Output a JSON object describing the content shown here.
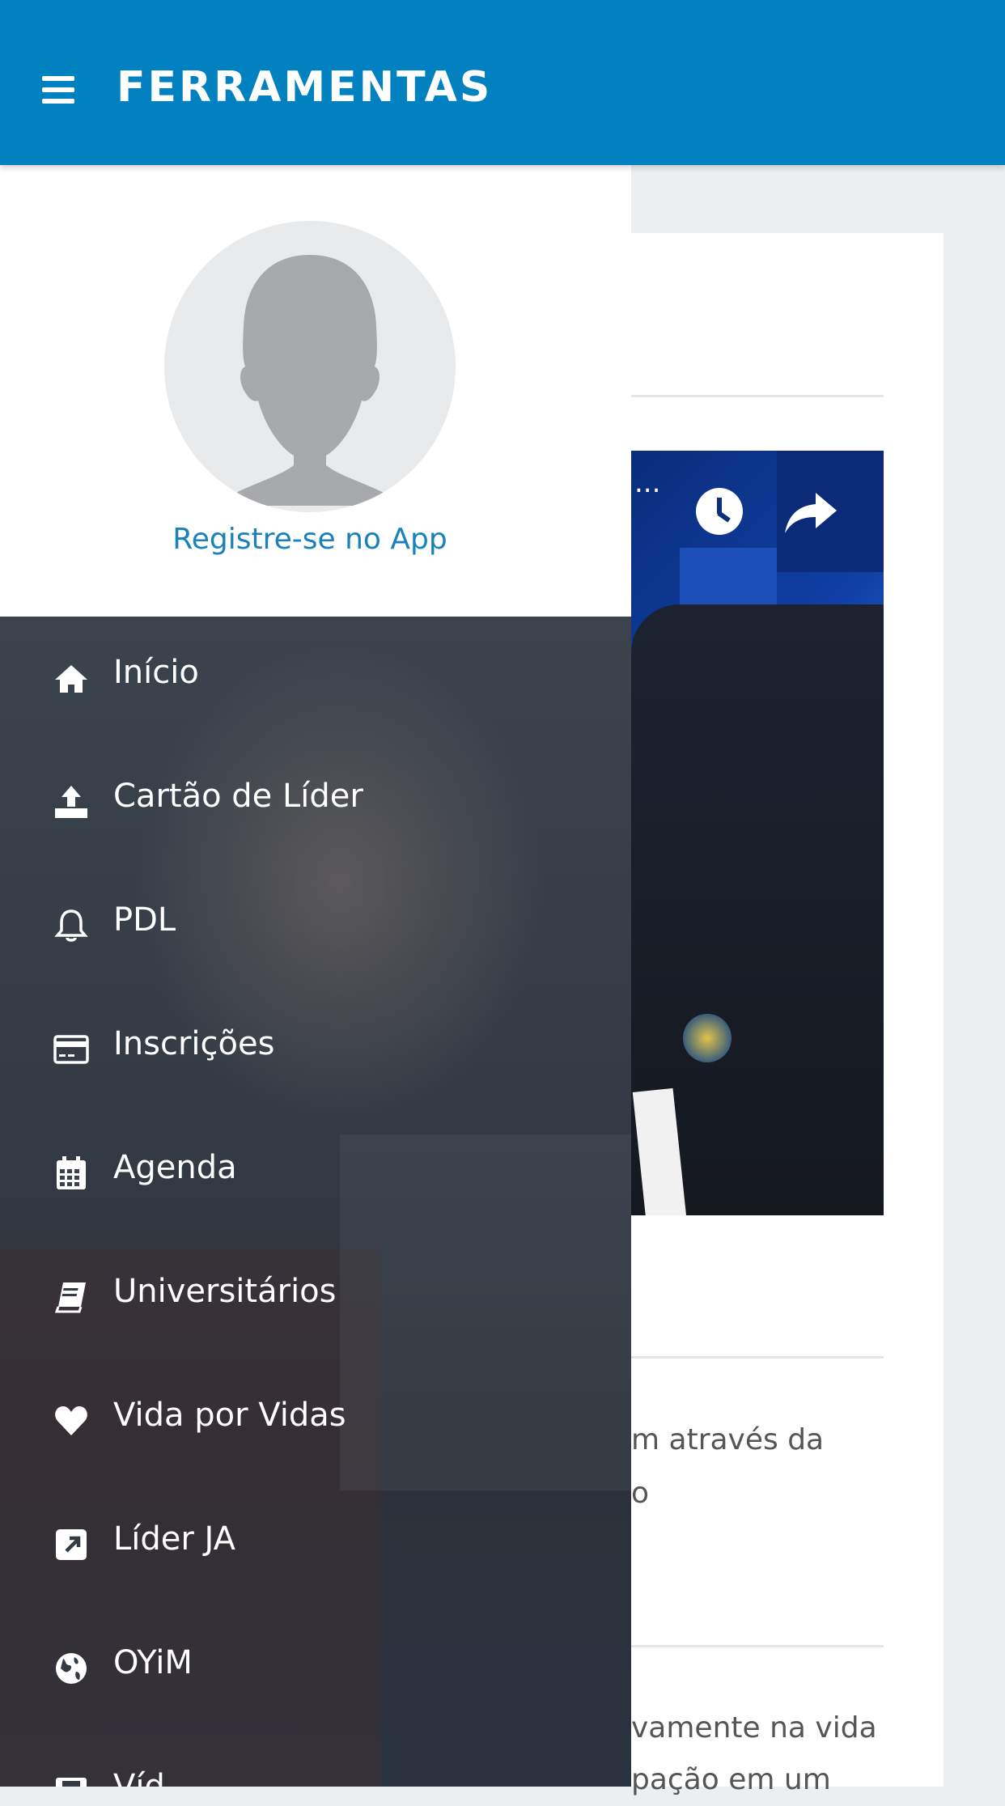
{
  "header": {
    "title": "FERRAMENTAS"
  },
  "drawer": {
    "register_label": "Registre-se no App",
    "items": [
      {
        "label": "Início",
        "icon": "home-icon"
      },
      {
        "label": "Cartão de Líder",
        "icon": "upload-icon"
      },
      {
        "label": "PDL",
        "icon": "bell-icon"
      },
      {
        "label": "Inscrições",
        "icon": "credit-card-icon"
      },
      {
        "label": "Agenda",
        "icon": "calendar-icon"
      },
      {
        "label": "Universitários",
        "icon": "book-icon"
      },
      {
        "label": "Vida por Vidas",
        "icon": "heart-icon"
      },
      {
        "label": "Líder JA",
        "icon": "external-link-icon"
      },
      {
        "label": "OYiM",
        "icon": "globe-icon"
      },
      {
        "label": "Víd",
        "icon": "film-icon"
      }
    ]
  },
  "background": {
    "video_dots": "...",
    "text_line_1": "m através da",
    "text_line_2": "o",
    "text_line_3": "vamente na vida",
    "text_line_4": "pação em um"
  }
}
